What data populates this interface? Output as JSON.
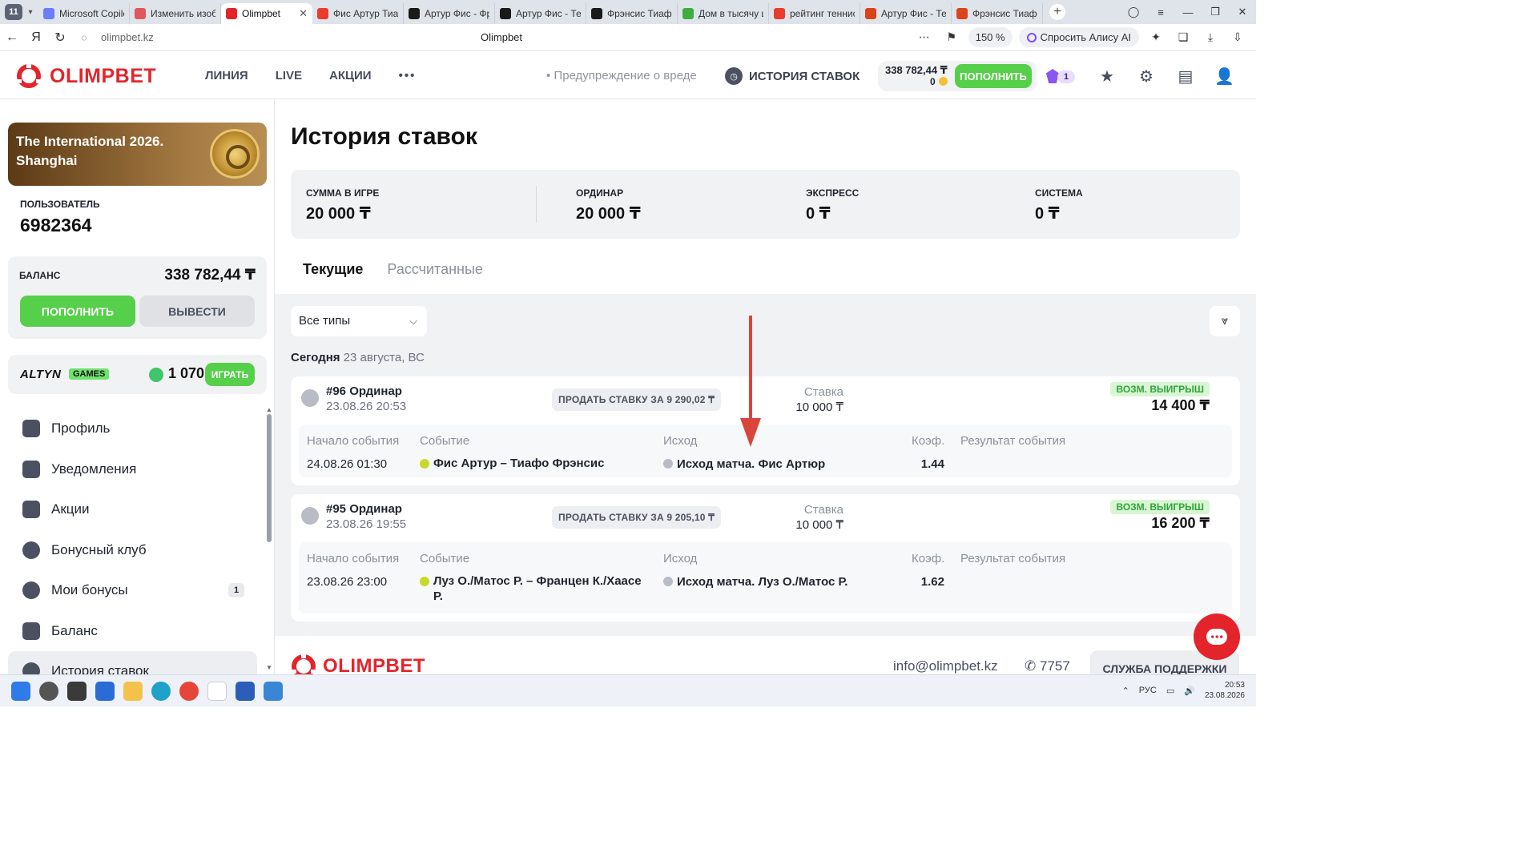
{
  "browser": {
    "tab_count": "11",
    "tabs": [
      {
        "title": "Microsoft Copilot",
        "color": "#6b7cff"
      },
      {
        "title": "Изменить изображение",
        "color": "#e0575e"
      },
      {
        "title": "Olimpbet",
        "color": "#e3252b",
        "active": true
      },
      {
        "title": "Фис Артур Тиафо",
        "color": "#e93c2f"
      },
      {
        "title": "Артур Фис - Фрэнсис",
        "color": "#1a1a1a"
      },
      {
        "title": "Артур Фис - Теннис",
        "color": "#1a1a1a"
      },
      {
        "title": "Фрэнсис Тиафо",
        "color": "#1a1a1a"
      },
      {
        "title": "Дом в тысячу ш",
        "color": "#3fae3f"
      },
      {
        "title": "рейтинг теннис",
        "color": "#e93c2f"
      },
      {
        "title": "Артур Фис - Те",
        "color": "#d9441b"
      },
      {
        "title": "Фрэнсис Тиафо",
        "color": "#d9441b"
      }
    ],
    "url": "olimpbet.kz",
    "page_title": "Olimpbet",
    "zoom": "150 %",
    "alice_label": "Спросить Алису AI"
  },
  "header": {
    "brand": "OLIMPBET",
    "nav": [
      "ЛИНИЯ",
      "LIVE",
      "АКЦИИ"
    ],
    "more": "•••",
    "warning": "• Предупреждение о вреде",
    "history_link": "ИСТОРИЯ СТАВОК",
    "balance": "338 782,44 ₸",
    "bonus_points": "0",
    "deposit": "ПОПОЛНИТЬ",
    "promo_count": "1"
  },
  "sidebar": {
    "banner_title": "The International 2026. Shanghai",
    "user_label": "ПОЛЬЗОВАТЕЛЬ",
    "user_id": "6982364",
    "balance_label": "БАЛАНС",
    "balance_value": "338 782,44 ₸",
    "deposit": "ПОПОЛНИТЬ",
    "withdraw": "ВЫВЕСТИ",
    "altyn_logo": "ALTYN",
    "altyn_games": "GAMES",
    "altyn_value": "1 070",
    "play": "ИГРАТЬ",
    "menu": [
      {
        "label": "Профиль",
        "icon": "user-icon"
      },
      {
        "label": "Уведомления",
        "icon": "message-icon"
      },
      {
        "label": "Акции",
        "icon": "gift-icon"
      },
      {
        "label": "Бонусный клуб",
        "icon": "club-icon"
      },
      {
        "label": "Мои бонусы",
        "icon": "star-icon",
        "count": "1"
      },
      {
        "label": "Баланс",
        "icon": "wallet-icon"
      },
      {
        "label": "История ставок",
        "icon": "history-icon",
        "active": true
      }
    ]
  },
  "main": {
    "title": "История ставок",
    "summary": [
      {
        "label": "СУММА В ИГРЕ",
        "value": "20 000 ₸"
      },
      {
        "label": "ОРДИНАР",
        "value": "20 000 ₸"
      },
      {
        "label": "ЭКСПРЕСС",
        "value": "0 ₸"
      },
      {
        "label": "СИСТЕМА",
        "value": "0 ₸"
      }
    ],
    "tabs": [
      "Текущие",
      "Рассчитанные"
    ],
    "filter": "Все типы",
    "day_bold": "Сегодня",
    "day_rest": "23 августа, ВС",
    "col_headers": {
      "start": "Начало события",
      "event": "Событие",
      "outcome": "Исход",
      "coef": "Коэф.",
      "result": "Результат события"
    },
    "stake_label": "Ставка",
    "win_label": "ВОЗМ. ВЫИГРЫШ",
    "bets": [
      {
        "id": "#96 Ординар",
        "datetime": "23.08.26 20:53",
        "sell": "ПРОДАТЬ СТАВКУ ЗА 9 290,02 ₸",
        "stake": "10 000 ₸",
        "win": "14 400 ₸",
        "start": "24.08.26 01:30",
        "event": "Фис Артур – Тиафо Фрэнсис",
        "outcome": "Исход матча. Фис Артюр",
        "coef": "1.44"
      },
      {
        "id": "#95 Ординар",
        "datetime": "23.08.26 19:55",
        "sell": "ПРОДАТЬ СТАВКУ ЗА 9 205,10 ₸",
        "stake": "10 000 ₸",
        "win": "16 200 ₸",
        "start": "23.08.26 23:00",
        "event": "Луз О./Матос Р. – Францен К./Хаасе Р.",
        "outcome": "Исход матча. Луз О./Матос Р.",
        "coef": "1.62"
      }
    ]
  },
  "footer": {
    "brand": "OLIMPBET",
    "email": "info@olimpbet.kz",
    "phone": "✆ 7757",
    "support": "СЛУЖБА ПОДДЕРЖКИ"
  },
  "taskbar": {
    "lang": "РУС",
    "time": "20:53",
    "date": "23.08.2026"
  }
}
